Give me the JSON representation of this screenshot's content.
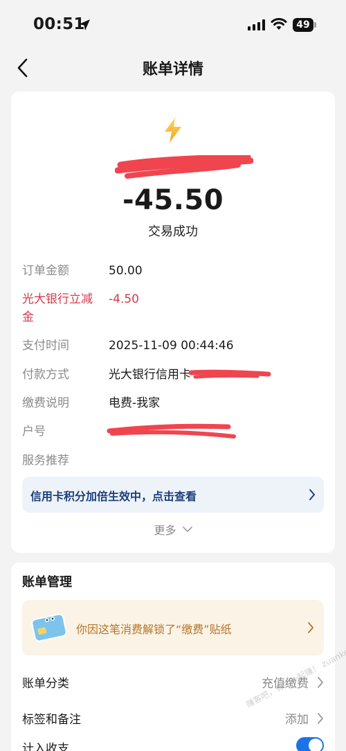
{
  "status_bar": {
    "time": "00:51",
    "battery": "49"
  },
  "nav": {
    "title": "账单详情"
  },
  "transaction": {
    "amount": "-45.50",
    "status": "交易成功"
  },
  "details": {
    "order_amount": {
      "label": "订单金额",
      "value": "50.00"
    },
    "discount": {
      "label": "光大银行立减金",
      "value": "-4.50"
    },
    "pay_time": {
      "label": "支付时间",
      "value": "2025-11-09 00:44:46"
    },
    "pay_method": {
      "label": "付款方式",
      "value": "光大银行信用卡"
    },
    "fee_note": {
      "label": "缴费说明",
      "value": "电费-我家"
    },
    "account_no": {
      "label": "户号",
      "value": ""
    },
    "service": {
      "label": "服务推荐"
    }
  },
  "promo": {
    "text": "信用卡积分加倍生效中，点击查看"
  },
  "more": {
    "label": "更多"
  },
  "manage": {
    "title": "账单管理",
    "sticker_text": "你因这笔消费解锁了“缴费”贴纸",
    "category": {
      "label": "账单分类",
      "value": "充值缴费"
    },
    "tags": {
      "label": "标签和备注",
      "value": "添加"
    },
    "partial_label": "计入收支"
  },
  "watermark": "赚客吧，有奖一起赚！ zuanke8.com",
  "colors": {
    "discount_red": "#d23b4b",
    "promo_blue": "#1b3f7a",
    "sticker_brown": "#b5752a",
    "toggle_blue": "#1a73e8",
    "redaction_red": "#f0454f",
    "bolt_orange": "#f5a623"
  },
  "icons": {
    "back": "chevron-left-icon",
    "bolt": "lightning-bolt-icon",
    "promo_chevron": "chevron-right-icon",
    "more_chevron": "chevron-down-icon",
    "sticker": "bank-card-sticker-icon"
  }
}
